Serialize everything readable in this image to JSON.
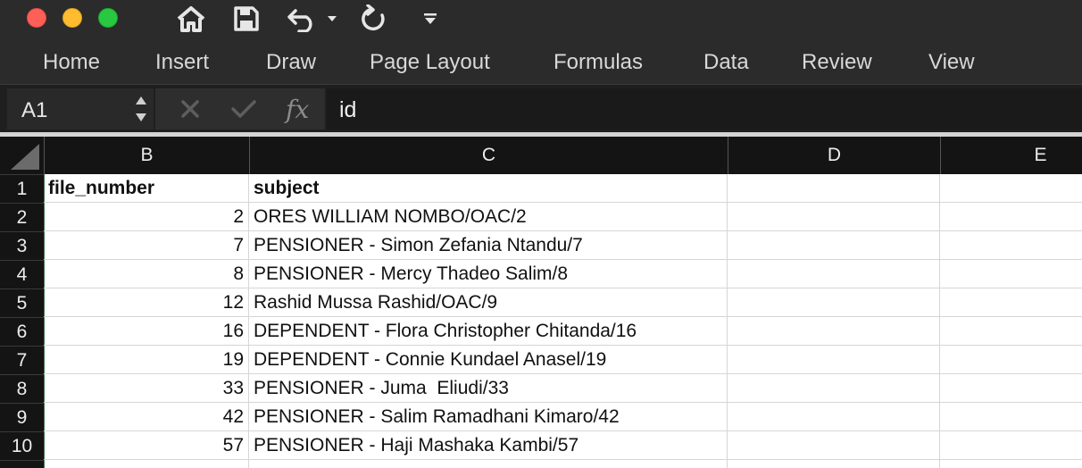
{
  "toolbar": {
    "home_icon": "home-icon",
    "save_icon": "save-icon",
    "undo_icon": "undo-icon",
    "redo_icon": "redo-icon",
    "customize_icon": "customize-toolbar-icon"
  },
  "ribbon": {
    "tabs": [
      "Home",
      "Insert",
      "Draw",
      "Page Layout",
      "Formulas",
      "Data",
      "Review",
      "View"
    ]
  },
  "formula_bar": {
    "cell_ref": "A1",
    "fx_label": "fx",
    "content": "id"
  },
  "sheet": {
    "columns": [
      "B",
      "C",
      "D",
      "E"
    ],
    "rows": [
      "1",
      "2",
      "3",
      "4",
      "5",
      "6",
      "7",
      "8",
      "9",
      "10"
    ],
    "header_cells": {
      "file_number": "file_number",
      "subject": "subject"
    },
    "data": [
      {
        "file_number": "2",
        "subject": "ORES WILLIAM NOMBO/OAC/2"
      },
      {
        "file_number": "7",
        "subject": "PENSIONER - Simon Zefania Ntandu/7"
      },
      {
        "file_number": "8",
        "subject": "PENSIONER - Mercy Thadeo Salim/8"
      },
      {
        "file_number": "12",
        "subject": "Rashid Mussa Rashid/OAC/9"
      },
      {
        "file_number": "16",
        "subject": "DEPENDENT - Flora Christopher Chitanda/16"
      },
      {
        "file_number": "19",
        "subject": "DEPENDENT - Connie Kundael Anasel/19"
      },
      {
        "file_number": "33",
        "subject": "PENSIONER - Juma  Eliudi/33"
      },
      {
        "file_number": "42",
        "subject": "PENSIONER - Salim Ramadhani Kimaro/42"
      },
      {
        "file_number": "57",
        "subject": "PENSIONER - Haji Mashaka Kambi/57"
      }
    ]
  },
  "colors": {
    "close": "#fe5f57",
    "minimize": "#febc2e",
    "zoom": "#28c840",
    "row_header_accent": "#3e6e47"
  }
}
